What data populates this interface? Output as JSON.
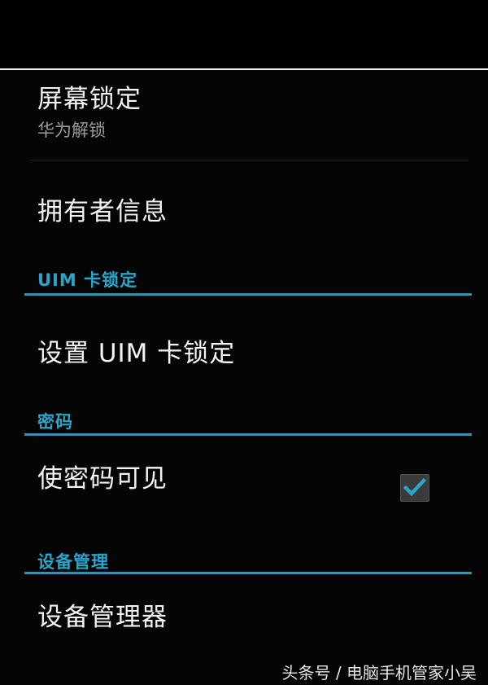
{
  "settings": {
    "screen_lock": {
      "title": "屏幕锁定",
      "summary": "华为解锁"
    },
    "owner_info": {
      "title": "拥有者信息"
    },
    "uim_section": {
      "title": "UIM 卡锁定"
    },
    "uim_lock": {
      "title": "设置 UIM 卡锁定"
    },
    "password_section": {
      "title": "密码"
    },
    "show_password": {
      "title": "使密码可见",
      "checked": true
    },
    "device_section": {
      "title": "设备管理"
    },
    "device_admin": {
      "title": "设备管理器"
    }
  },
  "watermark": "头条号 / 电脑手机管家小吴",
  "colors": {
    "accent": "#2aa5c9",
    "accent_line": "#3a8fb0",
    "background": "#000000",
    "primary_text": "#f4f4f4",
    "secondary_text": "#9a9a9a"
  },
  "icons": {
    "checkbox_mark": "check-icon"
  }
}
